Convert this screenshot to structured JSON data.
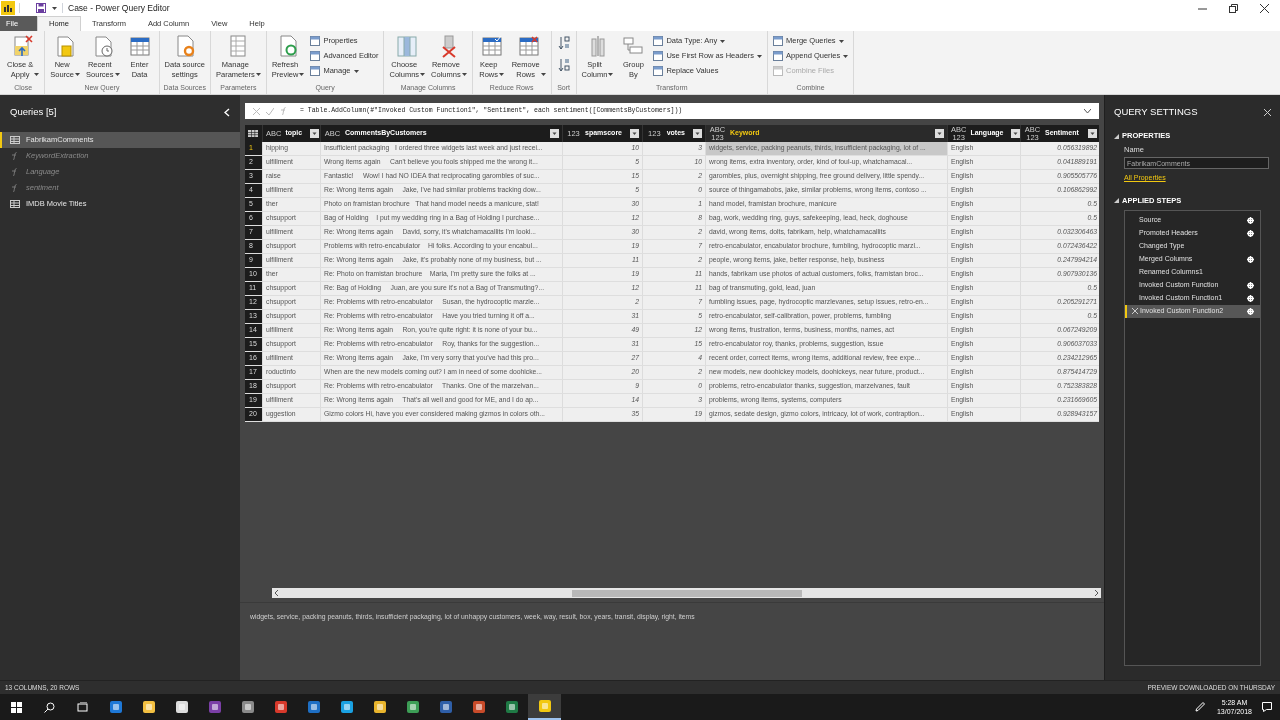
{
  "window": {
    "title": "Case - Power Query Editor"
  },
  "menu_tabs": [
    {
      "label": "File",
      "kind": "file",
      "selected": false
    },
    {
      "label": "Home",
      "kind": "tab",
      "selected": true
    },
    {
      "label": "Transform",
      "kind": "tab",
      "selected": false
    },
    {
      "label": "Add Column",
      "kind": "tab",
      "selected": false
    },
    {
      "label": "View",
      "kind": "tab",
      "selected": false
    },
    {
      "label": "Help",
      "kind": "tab",
      "selected": false
    }
  ],
  "ribbon_groups": [
    {
      "label": "Close",
      "items": [
        {
          "kind": "large",
          "label": "Close &\nApply",
          "dropdown": true
        }
      ]
    },
    {
      "label": "New Query",
      "items": [
        {
          "kind": "large",
          "label": "New\nSource",
          "dropdown": true
        },
        {
          "kind": "large",
          "label": "Recent\nSources",
          "dropdown": true
        },
        {
          "kind": "large",
          "label": "Enter\nData",
          "dropdown": false
        }
      ]
    },
    {
      "label": "Data Sources",
      "items": [
        {
          "kind": "large",
          "label": "Data source\nsettings",
          "dropdown": false
        }
      ]
    },
    {
      "label": "Parameters",
      "items": [
        {
          "kind": "large",
          "label": "Manage\nParameters",
          "dropdown": true
        }
      ]
    },
    {
      "label": "Query",
      "items": [
        {
          "kind": "large",
          "label": "Refresh\nPreview",
          "dropdown": true
        },
        {
          "kind": "stack",
          "items": [
            {
              "label": "Properties",
              "dropdown": false,
              "disabled": false
            },
            {
              "label": "Advanced Editor",
              "dropdown": false,
              "disabled": false
            },
            {
              "label": "Manage",
              "dropdown": true,
              "disabled": false
            }
          ]
        }
      ]
    },
    {
      "label": "Manage Columns",
      "items": [
        {
          "kind": "large",
          "label": "Choose\nColumns",
          "dropdown": true
        },
        {
          "kind": "large",
          "label": "Remove\nColumns",
          "dropdown": true
        }
      ]
    },
    {
      "label": "Reduce Rows",
      "items": [
        {
          "kind": "large",
          "label": "Keep\nRows",
          "dropdown": true
        },
        {
          "kind": "large",
          "label": "Remove\nRows",
          "dropdown": true
        }
      ]
    },
    {
      "label": "Sort",
      "items": [
        {
          "kind": "sort"
        }
      ]
    },
    {
      "label": "Transform",
      "items": [
        {
          "kind": "large",
          "label": "Split\nColumn",
          "dropdown": true
        },
        {
          "kind": "large",
          "label": "Group\nBy",
          "dropdown": false
        },
        {
          "kind": "stack",
          "items": [
            {
              "label": "Data Type: Any",
              "dropdown": true,
              "disabled": false
            },
            {
              "label": "Use First Row as Headers",
              "dropdown": true,
              "disabled": false
            },
            {
              "label": "Replace Values",
              "dropdown": false,
              "disabled": false
            }
          ]
        }
      ]
    },
    {
      "label": "Combine",
      "items": [
        {
          "kind": "stack",
          "items": [
            {
              "label": "Merge Queries",
              "dropdown": true,
              "disabled": false
            },
            {
              "label": "Append Queries",
              "dropdown": true,
              "disabled": false
            },
            {
              "label": "Combine Files",
              "dropdown": false,
              "disabled": true
            }
          ]
        }
      ]
    }
  ],
  "queries": {
    "title": "Queries [5]",
    "items": [
      {
        "label": "FabrikamComments",
        "kind": "table",
        "selected": true
      },
      {
        "label": "KeywordExtraction",
        "kind": "function",
        "selected": false
      },
      {
        "label": "Language",
        "kind": "function",
        "selected": false
      },
      {
        "label": "sentiment",
        "kind": "function",
        "selected": false
      },
      {
        "label": "IMDB Movie Titles",
        "kind": "table",
        "selected": false
      }
    ]
  },
  "formula_bar": {
    "formula": "= Table.AddColumn(#\"Invoked Custom Function1\", \"Sentiment\", each sentiment([CommentsByCustomers]))"
  },
  "table": {
    "columns": [
      {
        "name": "topic",
        "type_label": "ABC",
        "selected": false
      },
      {
        "name": "CommentsByCustomers",
        "type_label": "ABC",
        "selected": false
      },
      {
        "name": "spamscore",
        "type_label": "123",
        "selected": false
      },
      {
        "name": "votes",
        "type_label": "123",
        "selected": false
      },
      {
        "name": "Keyword",
        "type_label": "ABC 123",
        "selected": true
      },
      {
        "name": "Language",
        "type_label": "ABC 123",
        "selected": false
      },
      {
        "name": "Sentiment",
        "type_label": "ABC 123",
        "selected": false
      }
    ],
    "rows": [
      {
        "number": "1",
        "selected": true,
        "cells": [
          "hipping",
          "Insufficient packaging   I ordered three widgets last week and just recei...",
          "10",
          "3",
          "widgets, service, packing peanuts, thirds, insufficient packaging, lot of ...",
          "English",
          "0.056319892"
        ]
      },
      {
        "number": "2",
        "selected": false,
        "cells": [
          "ulfillment",
          "Wrong items again     Can't believe you fools shipped me the wrong it...",
          "5",
          "10",
          "wrong items, extra inventory, order, kind of foul-up, whatchamacal...",
          "English",
          "0.041889191"
        ]
      },
      {
        "number": "3",
        "selected": false,
        "cells": [
          "raise",
          "Fantastic!     Wow! I had NO IDEA that reciprocating garombles of suc...",
          "15",
          "2",
          "garombles, plus, overnight shipping, free ground delivery, little spendy...",
          "English",
          "0.905505776"
        ]
      },
      {
        "number": "4",
        "selected": false,
        "cells": [
          "ulfillment",
          "Re: Wrong items again     Jake, I've had similar problems tracking dow...",
          "5",
          "0",
          "source of thingamabobs, jake, similar problems, wrong items, contoso ...",
          "English",
          "0.106862992"
        ]
      },
      {
        "number": "5",
        "selected": false,
        "cells": [
          "ther",
          "Photo on framistan brochure   That hand model needs a manicure, stat!",
          "30",
          "1",
          "hand model, framistan brochure, manicure",
          "English",
          "0.5"
        ]
      },
      {
        "number": "6",
        "selected": false,
        "cells": [
          "chsupport",
          "Bag of Holding    I put my wedding ring in a Bag of Holding I purchase...",
          "12",
          "8",
          "bag, work, wedding ring, guys, safekeeping, lead, heck, doghouse",
          "English",
          "0.5"
        ]
      },
      {
        "number": "7",
        "selected": false,
        "cells": [
          "ulfillment",
          "Re: Wrong items again     David, sorry, it's whatchamacallits I'm looki...",
          "30",
          "2",
          "david, wrong items, dolts, fabrikam, help, whatchamacallits",
          "English",
          "0.032306463"
        ]
      },
      {
        "number": "8",
        "selected": false,
        "cells": [
          "chsupport",
          "Problems with retro-encabulator    Hi folks. According to your encabul...",
          "19",
          "7",
          "retro-encabulator, encabulator brochure, fumbling, hydrocoptic marzl...",
          "English",
          "0.072436422"
        ]
      },
      {
        "number": "9",
        "selected": false,
        "cells": [
          "ulfillment",
          "Re: Wrong items again     Jake, it's probably none of my business, but ...",
          "11",
          "2",
          "people, wrong items, jake, better response, help, business",
          "English",
          "0.247994214"
        ]
      },
      {
        "number": "10",
        "selected": false,
        "cells": [
          "ther",
          "Re: Photo on framistan brochure    Maria, I'm pretty sure the folks at ...",
          "19",
          "11",
          "hands, fabrikam use photos of actual customers, folks, framistan broc...",
          "English",
          "0.907930136"
        ]
      },
      {
        "number": "11",
        "selected": false,
        "cells": [
          "chsupport",
          "Re: Bag of Holding     Juan, are you sure it's not a Bag of Transmuting?...",
          "12",
          "11",
          "bag of transmuting, gold, lead, juan",
          "English",
          "0.5"
        ]
      },
      {
        "number": "12",
        "selected": false,
        "cells": [
          "chsupport",
          "Re: Problems with retro-encabulator     Susan, the hydrocoptic marzle...",
          "2",
          "7",
          "fumbling issues, page, hydrocoptic marzlevanes, setup issues, retro-en...",
          "English",
          "0.205291271"
        ]
      },
      {
        "number": "13",
        "selected": false,
        "cells": [
          "chsupport",
          "Re: Problems with retro-encabulator     Have you tried turning it off a...",
          "31",
          "5",
          "retro-encabulator, self-calibration, power, problems, fumbling",
          "English",
          "0.5"
        ]
      },
      {
        "number": "14",
        "selected": false,
        "cells": [
          "ulfillment",
          "Re: Wrong items again     Ron, you're quite right: it is none of your bu...",
          "49",
          "12",
          "wrong items, frustration, terms, business, months, names, act",
          "English",
          "0.067249209"
        ]
      },
      {
        "number": "15",
        "selected": false,
        "cells": [
          "chsupport",
          "Re: Problems with retro-encabulator     Roy, thanks for the suggestion...",
          "31",
          "15",
          "retro-encabulator roy, thanks, problems, suggestion, issue",
          "English",
          "0.906037033"
        ]
      },
      {
        "number": "16",
        "selected": false,
        "cells": [
          "ulfillment",
          "Re: Wrong items again     Jake, I'm very sorry that you've had this pro...",
          "27",
          "4",
          "recent order, correct items, wrong items, additional review, free expe...",
          "English",
          "0.234212965"
        ]
      },
      {
        "number": "17",
        "selected": false,
        "cells": [
          "roductinfo",
          "When are the new models coming out? I am in need of some doohicke...",
          "20",
          "2",
          "new models, new doohickey models, doohickeys, near future, product...",
          "English",
          "0.875414729"
        ]
      },
      {
        "number": "18",
        "selected": false,
        "cells": [
          "chsupport",
          "Re: Problems with retro-encabulator     Thanks. One of the marzelvan...",
          "9",
          "0",
          "problems, retro-encabulator thanks, suggestion, marzelvanes, fault",
          "English",
          "0.752383828"
        ]
      },
      {
        "number": "19",
        "selected": false,
        "cells": [
          "ulfillment",
          "Re: Wrong items again     That's all well and good for ME, and I do ap...",
          "14",
          "3",
          "problems, wrong items, systems, computers",
          "English",
          "0.231669605"
        ]
      },
      {
        "number": "20",
        "selected": false,
        "cells": [
          "uggestion",
          "Gizmo colors Hi, have you ever considered making gizmos in colors oth...",
          "35",
          "19",
          "gizmos, sedate design, gizmo colors, intricacy, lot of work, contraption...",
          "English",
          "0.928943157"
        ]
      }
    ]
  },
  "cell_detail": "widgets, service, packing peanuts, thirds, insufficient packaging, lot of unhappy customers, week, way, result, box, years, transit, display, right, items",
  "query_settings": {
    "title": "QUERY SETTINGS",
    "properties_heading": "PROPERTIES",
    "name_label": "Name",
    "name_value": "FabrikamComments",
    "all_properties_link": "All Properties",
    "steps_heading": "APPLIED STEPS",
    "steps": [
      {
        "label": "Source",
        "has_settings": true,
        "selected": false
      },
      {
        "label": "Promoted Headers",
        "has_settings": true,
        "selected": false
      },
      {
        "label": "Changed Type",
        "has_settings": false,
        "selected": false
      },
      {
        "label": "Merged Columns",
        "has_settings": true,
        "selected": false
      },
      {
        "label": "Renamed Columns1",
        "has_settings": false,
        "selected": false
      },
      {
        "label": "Invoked Custom Function",
        "has_settings": true,
        "selected": false
      },
      {
        "label": "Invoked Custom Function1",
        "has_settings": true,
        "selected": false
      },
      {
        "label": "Invoked Custom Function2",
        "has_settings": true,
        "selected": true
      }
    ]
  },
  "status_bar": {
    "left": "13 COLUMNS, 20 ROWS",
    "right": "PREVIEW DOWNLOADED ON THURSDAY"
  },
  "taskbar": {
    "time": "5:28 AM",
    "date": "13/07/2018"
  }
}
